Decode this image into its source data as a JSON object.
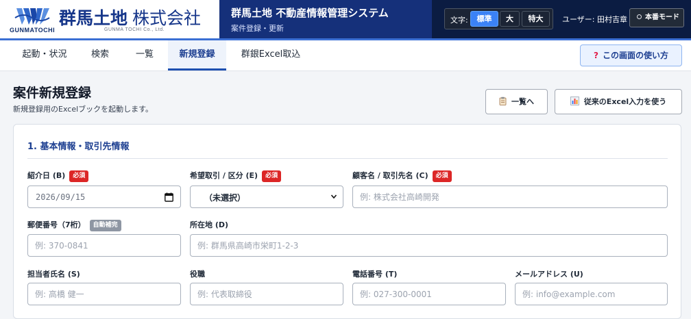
{
  "header": {
    "logo_sub": "GUNMATOCHI",
    "brand_name": "群馬土地",
    "brand_kk": "株式会社",
    "brand_en": "GUNMA TOCHI Co., Ltd.",
    "system_title": "群馬土地 不動産情報管理システム",
    "system_subtitle": "案件登録・更新",
    "font_size_label": "文字:",
    "font_sizes": [
      "標準",
      "大",
      "特大"
    ],
    "font_size_selected": "標準",
    "user": "ユーザー: 田村吉章",
    "mode_label": "本番モード"
  },
  "nav": {
    "items": [
      "起動・状況",
      "検索",
      "一覧",
      "新規登録",
      "群銀Excel取込"
    ],
    "active": "新規登録",
    "help_label": "この画面の使い方"
  },
  "page": {
    "title": "案件新規登録",
    "description": "新規登録用のExcelブックを起動します。",
    "list_button": "一覧へ",
    "excel_button": "従来のExcel入力を使う"
  },
  "section": {
    "title": "1. 基本情報・取引先情報"
  },
  "fields": {
    "intro_date": {
      "label": "紹介日 (B)",
      "badge": "必須",
      "value": "2026/09/15"
    },
    "deal_type": {
      "label": "希望取引 / 区分 (E)",
      "badge": "必須",
      "value": "（未選択）"
    },
    "customer": {
      "label": "顧客名 / 取引先名 (C)",
      "badge": "必須",
      "placeholder": "例: 株式会社高崎開発"
    },
    "postal": {
      "label": "郵便番号（7桁）",
      "badge": "自動補完",
      "placeholder": "例: 370-0841"
    },
    "address": {
      "label": "所在地 (D)",
      "placeholder": "例: 群馬県高崎市栄町1-2-3"
    },
    "contact_name": {
      "label": "担当者氏名 (S)",
      "placeholder": "例: 高橋 健一"
    },
    "position": {
      "label": "役職",
      "placeholder": "例: 代表取締役"
    },
    "phone": {
      "label": "電話番号 (T)",
      "placeholder": "例: 027-300-0001"
    },
    "email": {
      "label": "メールアドレス (U)",
      "placeholder": "例: info@example.com"
    }
  },
  "colors": {
    "header_bg": "#0b1c42",
    "system_bg": "#15307a",
    "accent": "#1d4fb0",
    "required_badge": "#dc2626"
  }
}
